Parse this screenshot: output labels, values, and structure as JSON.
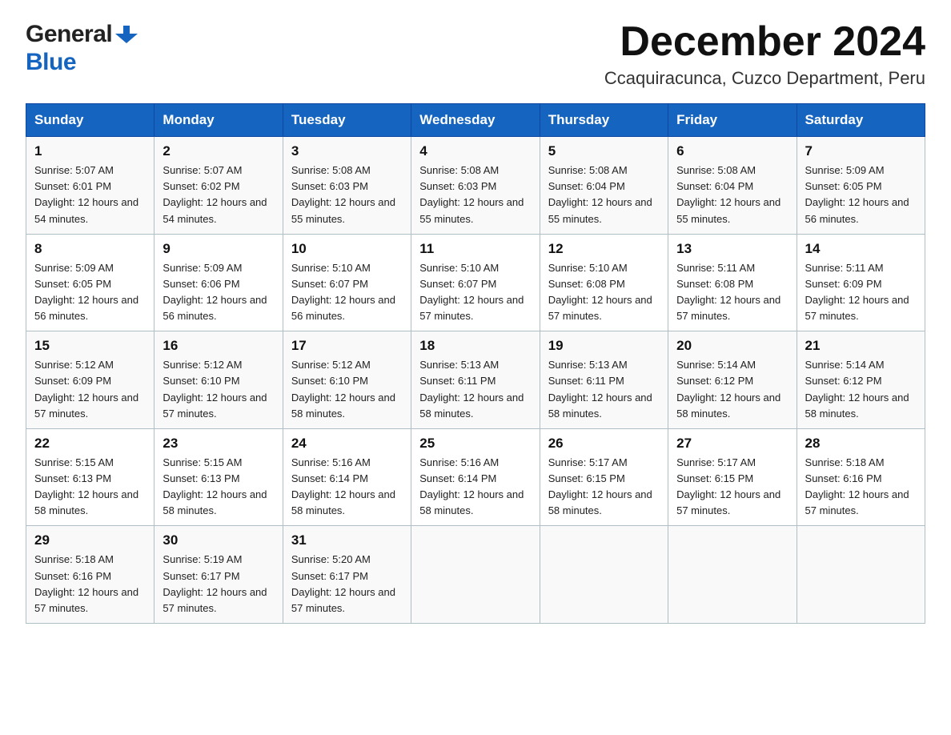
{
  "logo": {
    "general": "General",
    "blue": "Blue"
  },
  "title": "December 2024",
  "subtitle": "Ccaquiracunca, Cuzco Department, Peru",
  "weekdays": [
    "Sunday",
    "Monday",
    "Tuesday",
    "Wednesday",
    "Thursday",
    "Friday",
    "Saturday"
  ],
  "weeks": [
    [
      {
        "day": "1",
        "sunrise": "5:07 AM",
        "sunset": "6:01 PM",
        "daylight": "12 hours and 54 minutes."
      },
      {
        "day": "2",
        "sunrise": "5:07 AM",
        "sunset": "6:02 PM",
        "daylight": "12 hours and 54 minutes."
      },
      {
        "day": "3",
        "sunrise": "5:08 AM",
        "sunset": "6:03 PM",
        "daylight": "12 hours and 55 minutes."
      },
      {
        "day": "4",
        "sunrise": "5:08 AM",
        "sunset": "6:03 PM",
        "daylight": "12 hours and 55 minutes."
      },
      {
        "day": "5",
        "sunrise": "5:08 AM",
        "sunset": "6:04 PM",
        "daylight": "12 hours and 55 minutes."
      },
      {
        "day": "6",
        "sunrise": "5:08 AM",
        "sunset": "6:04 PM",
        "daylight": "12 hours and 55 minutes."
      },
      {
        "day": "7",
        "sunrise": "5:09 AM",
        "sunset": "6:05 PM",
        "daylight": "12 hours and 56 minutes."
      }
    ],
    [
      {
        "day": "8",
        "sunrise": "5:09 AM",
        "sunset": "6:05 PM",
        "daylight": "12 hours and 56 minutes."
      },
      {
        "day": "9",
        "sunrise": "5:09 AM",
        "sunset": "6:06 PM",
        "daylight": "12 hours and 56 minutes."
      },
      {
        "day": "10",
        "sunrise": "5:10 AM",
        "sunset": "6:07 PM",
        "daylight": "12 hours and 56 minutes."
      },
      {
        "day": "11",
        "sunrise": "5:10 AM",
        "sunset": "6:07 PM",
        "daylight": "12 hours and 57 minutes."
      },
      {
        "day": "12",
        "sunrise": "5:10 AM",
        "sunset": "6:08 PM",
        "daylight": "12 hours and 57 minutes."
      },
      {
        "day": "13",
        "sunrise": "5:11 AM",
        "sunset": "6:08 PM",
        "daylight": "12 hours and 57 minutes."
      },
      {
        "day": "14",
        "sunrise": "5:11 AM",
        "sunset": "6:09 PM",
        "daylight": "12 hours and 57 minutes."
      }
    ],
    [
      {
        "day": "15",
        "sunrise": "5:12 AM",
        "sunset": "6:09 PM",
        "daylight": "12 hours and 57 minutes."
      },
      {
        "day": "16",
        "sunrise": "5:12 AM",
        "sunset": "6:10 PM",
        "daylight": "12 hours and 57 minutes."
      },
      {
        "day": "17",
        "sunrise": "5:12 AM",
        "sunset": "6:10 PM",
        "daylight": "12 hours and 58 minutes."
      },
      {
        "day": "18",
        "sunrise": "5:13 AM",
        "sunset": "6:11 PM",
        "daylight": "12 hours and 58 minutes."
      },
      {
        "day": "19",
        "sunrise": "5:13 AM",
        "sunset": "6:11 PM",
        "daylight": "12 hours and 58 minutes."
      },
      {
        "day": "20",
        "sunrise": "5:14 AM",
        "sunset": "6:12 PM",
        "daylight": "12 hours and 58 minutes."
      },
      {
        "day": "21",
        "sunrise": "5:14 AM",
        "sunset": "6:12 PM",
        "daylight": "12 hours and 58 minutes."
      }
    ],
    [
      {
        "day": "22",
        "sunrise": "5:15 AM",
        "sunset": "6:13 PM",
        "daylight": "12 hours and 58 minutes."
      },
      {
        "day": "23",
        "sunrise": "5:15 AM",
        "sunset": "6:13 PM",
        "daylight": "12 hours and 58 minutes."
      },
      {
        "day": "24",
        "sunrise": "5:16 AM",
        "sunset": "6:14 PM",
        "daylight": "12 hours and 58 minutes."
      },
      {
        "day": "25",
        "sunrise": "5:16 AM",
        "sunset": "6:14 PM",
        "daylight": "12 hours and 58 minutes."
      },
      {
        "day": "26",
        "sunrise": "5:17 AM",
        "sunset": "6:15 PM",
        "daylight": "12 hours and 58 minutes."
      },
      {
        "day": "27",
        "sunrise": "5:17 AM",
        "sunset": "6:15 PM",
        "daylight": "12 hours and 57 minutes."
      },
      {
        "day": "28",
        "sunrise": "5:18 AM",
        "sunset": "6:16 PM",
        "daylight": "12 hours and 57 minutes."
      }
    ],
    [
      {
        "day": "29",
        "sunrise": "5:18 AM",
        "sunset": "6:16 PM",
        "daylight": "12 hours and 57 minutes."
      },
      {
        "day": "30",
        "sunrise": "5:19 AM",
        "sunset": "6:17 PM",
        "daylight": "12 hours and 57 minutes."
      },
      {
        "day": "31",
        "sunrise": "5:20 AM",
        "sunset": "6:17 PM",
        "daylight": "12 hours and 57 minutes."
      },
      null,
      null,
      null,
      null
    ]
  ]
}
